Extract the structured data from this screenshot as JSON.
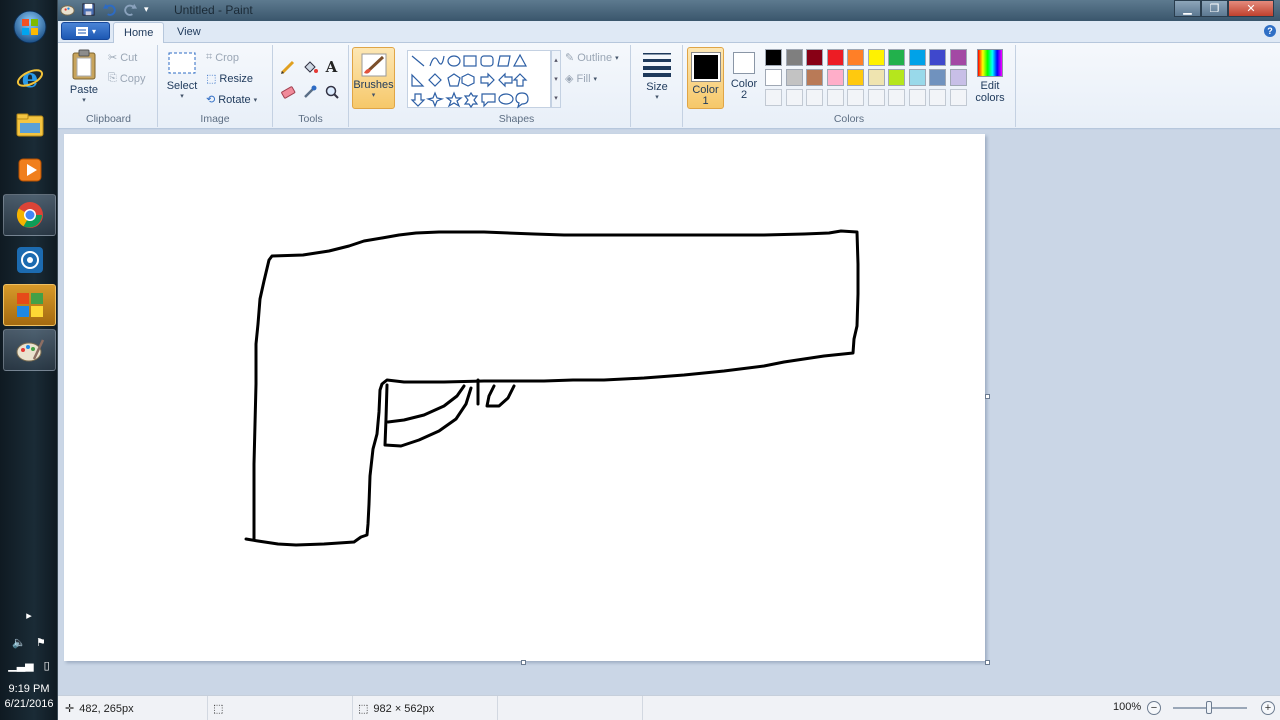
{
  "window": {
    "title": "Untitled - Paint"
  },
  "tabs": [
    {
      "label": "Home",
      "selected": true
    },
    {
      "label": "View",
      "selected": false
    }
  ],
  "ribbon": {
    "clipboard": {
      "group": "Clipboard",
      "paste": "Paste",
      "cut": "Cut",
      "copy": "Copy"
    },
    "image": {
      "group": "Image",
      "select": "Select",
      "crop": "Crop",
      "resize": "Resize",
      "rotate": "Rotate"
    },
    "tools": {
      "group": "Tools"
    },
    "brushes": {
      "label": "Brushes"
    },
    "shapes": {
      "group": "Shapes",
      "outline": "Outline",
      "fill": "Fill"
    },
    "size": {
      "label": "Size"
    },
    "colors": {
      "group": "Colors",
      "color1": {
        "label": "Color",
        "num": "1",
        "value": "#000000"
      },
      "color2": {
        "label": "Color",
        "num": "2",
        "value": "#ffffff"
      },
      "edit": {
        "line1": "Edit",
        "line2": "colors"
      },
      "palette_row1": [
        "#000000",
        "#7f7f7f",
        "#880015",
        "#ed1c24",
        "#ff7f27",
        "#fff200",
        "#22b14c",
        "#00a2e8",
        "#3f48cc",
        "#a349a4"
      ],
      "palette_row2": [
        "#ffffff",
        "#c3c3c3",
        "#b97a57",
        "#ffaec9",
        "#ffc90e",
        "#efe4b0",
        "#b5e61d",
        "#99d9ea",
        "#7092be",
        "#c8bfe7"
      ]
    }
  },
  "status": {
    "cursor_pos": "482, 265px",
    "image_size": "982 × 562px",
    "zoom": "100%"
  },
  "taskbar": {
    "time": "9:19 PM",
    "date": "6/21/2016",
    "apps": [
      "start-orb",
      "internet-explorer",
      "file-explorer",
      "media-player",
      "chrome",
      "network-app",
      "avast",
      "paint"
    ]
  }
}
